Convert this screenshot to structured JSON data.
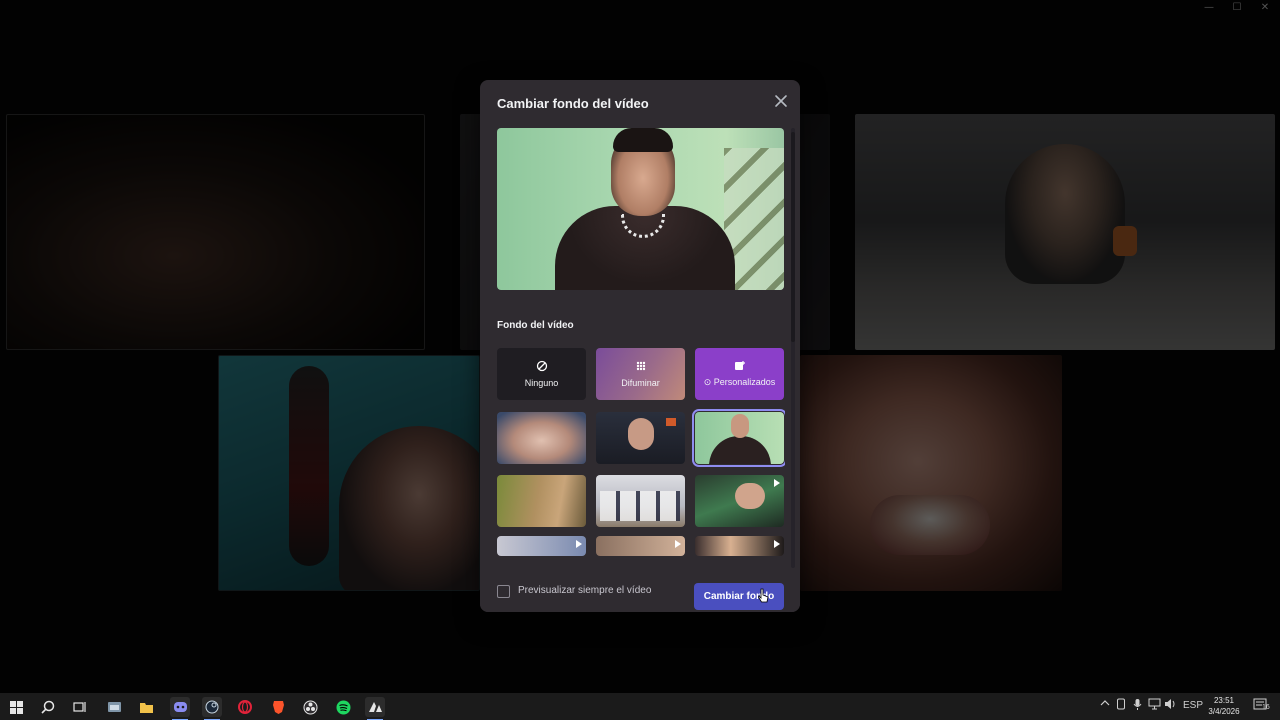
{
  "modal": {
    "title": "Cambiar fondo del vídeo",
    "section_label": "Fondo del vídeo",
    "options": {
      "none": "Ninguno",
      "blur": "Difuminar",
      "custom": "Personalizados"
    },
    "thumbnails": [
      {
        "name": "background-thumb-1",
        "video": false,
        "selected": false
      },
      {
        "name": "background-thumb-2",
        "video": false,
        "selected": false
      },
      {
        "name": "background-thumb-3",
        "video": false,
        "selected": true
      },
      {
        "name": "background-thumb-4",
        "video": false,
        "selected": false
      },
      {
        "name": "background-thumb-5",
        "video": false,
        "selected": false
      },
      {
        "name": "background-thumb-6",
        "video": true,
        "selected": false
      },
      {
        "name": "background-thumb-7",
        "video": true,
        "selected": false
      },
      {
        "name": "background-thumb-8",
        "video": true,
        "selected": false
      },
      {
        "name": "background-thumb-9",
        "video": true,
        "selected": false
      }
    ],
    "always_preview_label": "Previsualizar siempre el vídeo",
    "always_preview_checked": false,
    "apply_button": "Cambiar fondo"
  },
  "taskbar": {
    "language": "ESP",
    "time": "23:51",
    "date": "3/4/2026",
    "notification_count": "16",
    "apps": [
      "start-icon",
      "search-icon",
      "task-view-icon",
      "file-manager-icon",
      "file-explorer-icon",
      "discord-icon",
      "steam-icon",
      "opera-icon",
      "brave-icon",
      "obs-icon",
      "spotify-icon",
      "app-icon"
    ]
  },
  "colors": {
    "modal_bg": "#2f2b30",
    "accent": "#4a4fbf",
    "custom_option": "#8b3fc9",
    "selected_outline": "#8f8cf0"
  }
}
